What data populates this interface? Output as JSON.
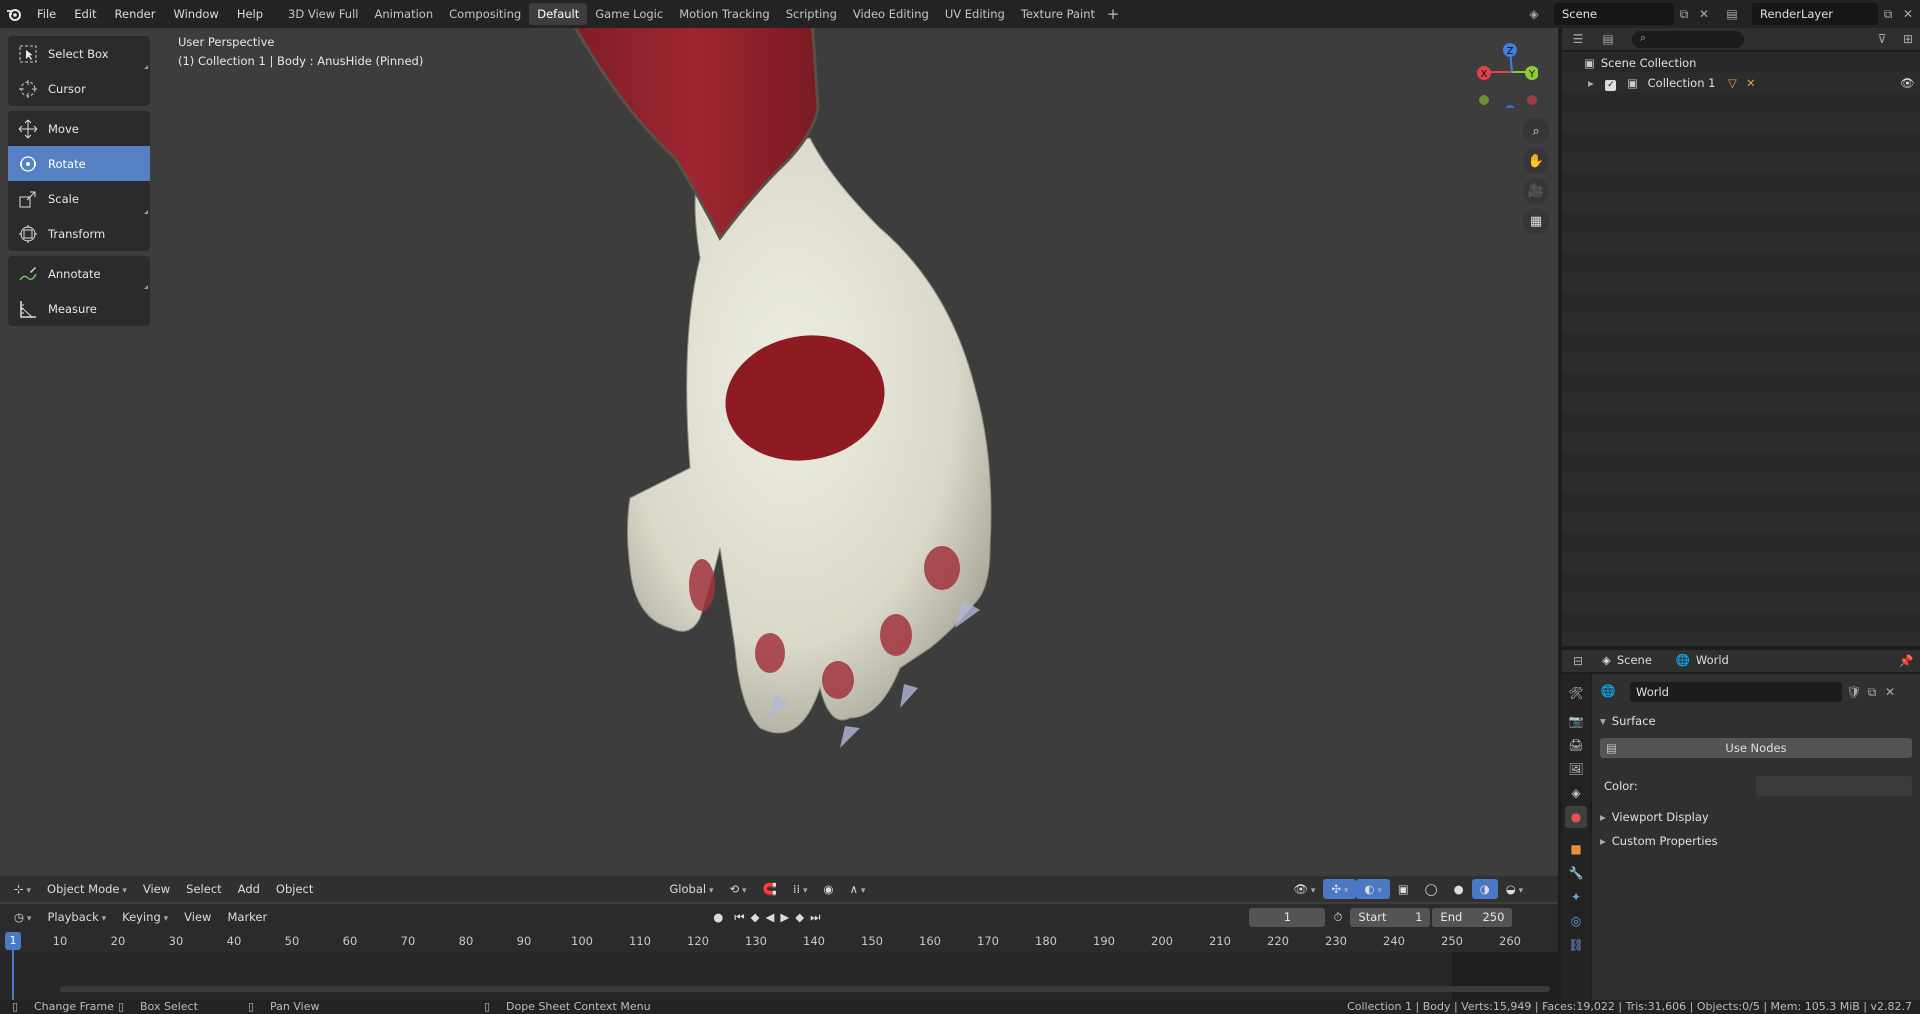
{
  "menu": [
    "File",
    "Edit",
    "Render",
    "Window",
    "Help"
  ],
  "workspaces": [
    "3D View Full",
    "Animation",
    "Compositing",
    "Default",
    "Game Logic",
    "Motion Tracking",
    "Scripting",
    "Video Editing",
    "UV Editing",
    "Texture Paint"
  ],
  "active_workspace": "Default",
  "scene_name": "Scene",
  "render_layer": "RenderLayer",
  "viewport": {
    "perspective": "User Perspective",
    "info": "(1) Collection 1 | Body : AnusHide (Pinned)"
  },
  "tools": [
    {
      "label": "Select Box",
      "icon": "select-box-icon"
    },
    {
      "label": "Cursor",
      "icon": "cursor-icon"
    },
    {
      "label": "Move",
      "icon": "move-icon"
    },
    {
      "label": "Rotate",
      "icon": "rotate-icon"
    },
    {
      "label": "Scale",
      "icon": "scale-icon"
    },
    {
      "label": "Transform",
      "icon": "transform-icon"
    },
    {
      "label": "Annotate",
      "icon": "annotate-icon"
    },
    {
      "label": "Measure",
      "icon": "measure-icon"
    }
  ],
  "active_tool": "Rotate",
  "gizmo": {
    "x": "X",
    "y": "Y",
    "z": "Z"
  },
  "header": {
    "mode": "Object Mode",
    "view": "View",
    "select": "Select",
    "add": "Add",
    "object": "Object",
    "orientation": "Global"
  },
  "timeline": {
    "playback": "Playback",
    "keying": "Keying",
    "view": "View",
    "marker": "Marker",
    "current_frame": "1",
    "start_label": "Start",
    "start": "1",
    "end_label": "End",
    "end": "250",
    "ticks": [
      "10",
      "20",
      "30",
      "40",
      "50",
      "60",
      "70",
      "80",
      "90",
      "100",
      "110",
      "120",
      "130",
      "140",
      "150",
      "160",
      "170",
      "180",
      "190",
      "200",
      "210",
      "220",
      "230",
      "240",
      "250",
      "260"
    ],
    "cursor_frame": "1"
  },
  "outliner": {
    "root": "Scene Collection",
    "collection": "Collection 1"
  },
  "properties": {
    "breadcrumb_scene": "Scene",
    "breadcrumb_world": "World",
    "world_name": "World",
    "surface": "Surface",
    "use_nodes": "Use Nodes",
    "color_label": "Color:",
    "viewport_display": "Viewport Display",
    "custom_properties": "Custom Properties"
  },
  "status": {
    "change_frame": "Change Frame",
    "box_select": "Box Select",
    "pan_view": "Pan View",
    "context_menu": "Dope Sheet Context Menu",
    "stats": "Collection 1 | Body | Verts:15,949 | Faces:19,022 | Tris:31,606 | Objects:0/5 | Mem: 105.3 MiB | v2.82.7"
  },
  "colors": {
    "accent_blue": "#5680c2",
    "axis_x": "#e2424b",
    "axis_y": "#8fc93a",
    "axis_z": "#3f7fde",
    "viewport_bg": "#3d3d3d"
  }
}
